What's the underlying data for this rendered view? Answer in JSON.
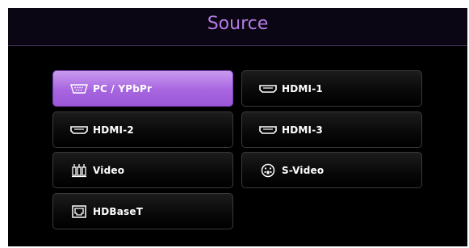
{
  "title": "Source",
  "colors": {
    "accent": "#b57be6",
    "selected_bg": "#a765df",
    "button_bg": "#0b0b0b",
    "panel_bg": "#000000"
  },
  "sources": [
    {
      "label": "PC / YPbPr",
      "icon": "vga-icon",
      "selected": true
    },
    {
      "label": "HDMI-1",
      "icon": "hdmi-icon",
      "selected": false
    },
    {
      "label": "HDMI-2",
      "icon": "hdmi-icon",
      "selected": false
    },
    {
      "label": "HDMI-3",
      "icon": "hdmi-icon",
      "selected": false
    },
    {
      "label": "Video",
      "icon": "rca-icon",
      "selected": false
    },
    {
      "label": "S-Video",
      "icon": "svideo-icon",
      "selected": false
    },
    {
      "label": "HDBaseT",
      "icon": "rj45-icon",
      "selected": false
    }
  ]
}
